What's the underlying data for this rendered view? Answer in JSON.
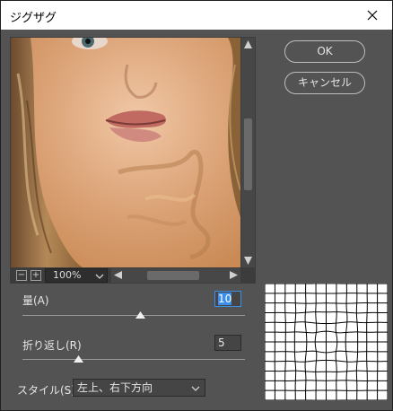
{
  "window": {
    "title": "ジグザグ",
    "close_label": "×"
  },
  "buttons": {
    "ok_label": "OK",
    "cancel_label": "キャンセル"
  },
  "preview": {
    "zoom_out_label": "−",
    "zoom_in_label": "+",
    "zoom_level": "100%"
  },
  "params": {
    "amount": {
      "label": "量(A)",
      "value": "10",
      "slider_fraction": 0.53
    },
    "ridges": {
      "label": "折り返し(R)",
      "value": "5",
      "slider_fraction": 0.25
    },
    "style": {
      "label": "スタイル(S)",
      "value": "左上、右下方向"
    }
  },
  "colors": {
    "dialog_bg": "#535353",
    "accent": "#3d8ee8",
    "text": "#e6e6e6"
  }
}
